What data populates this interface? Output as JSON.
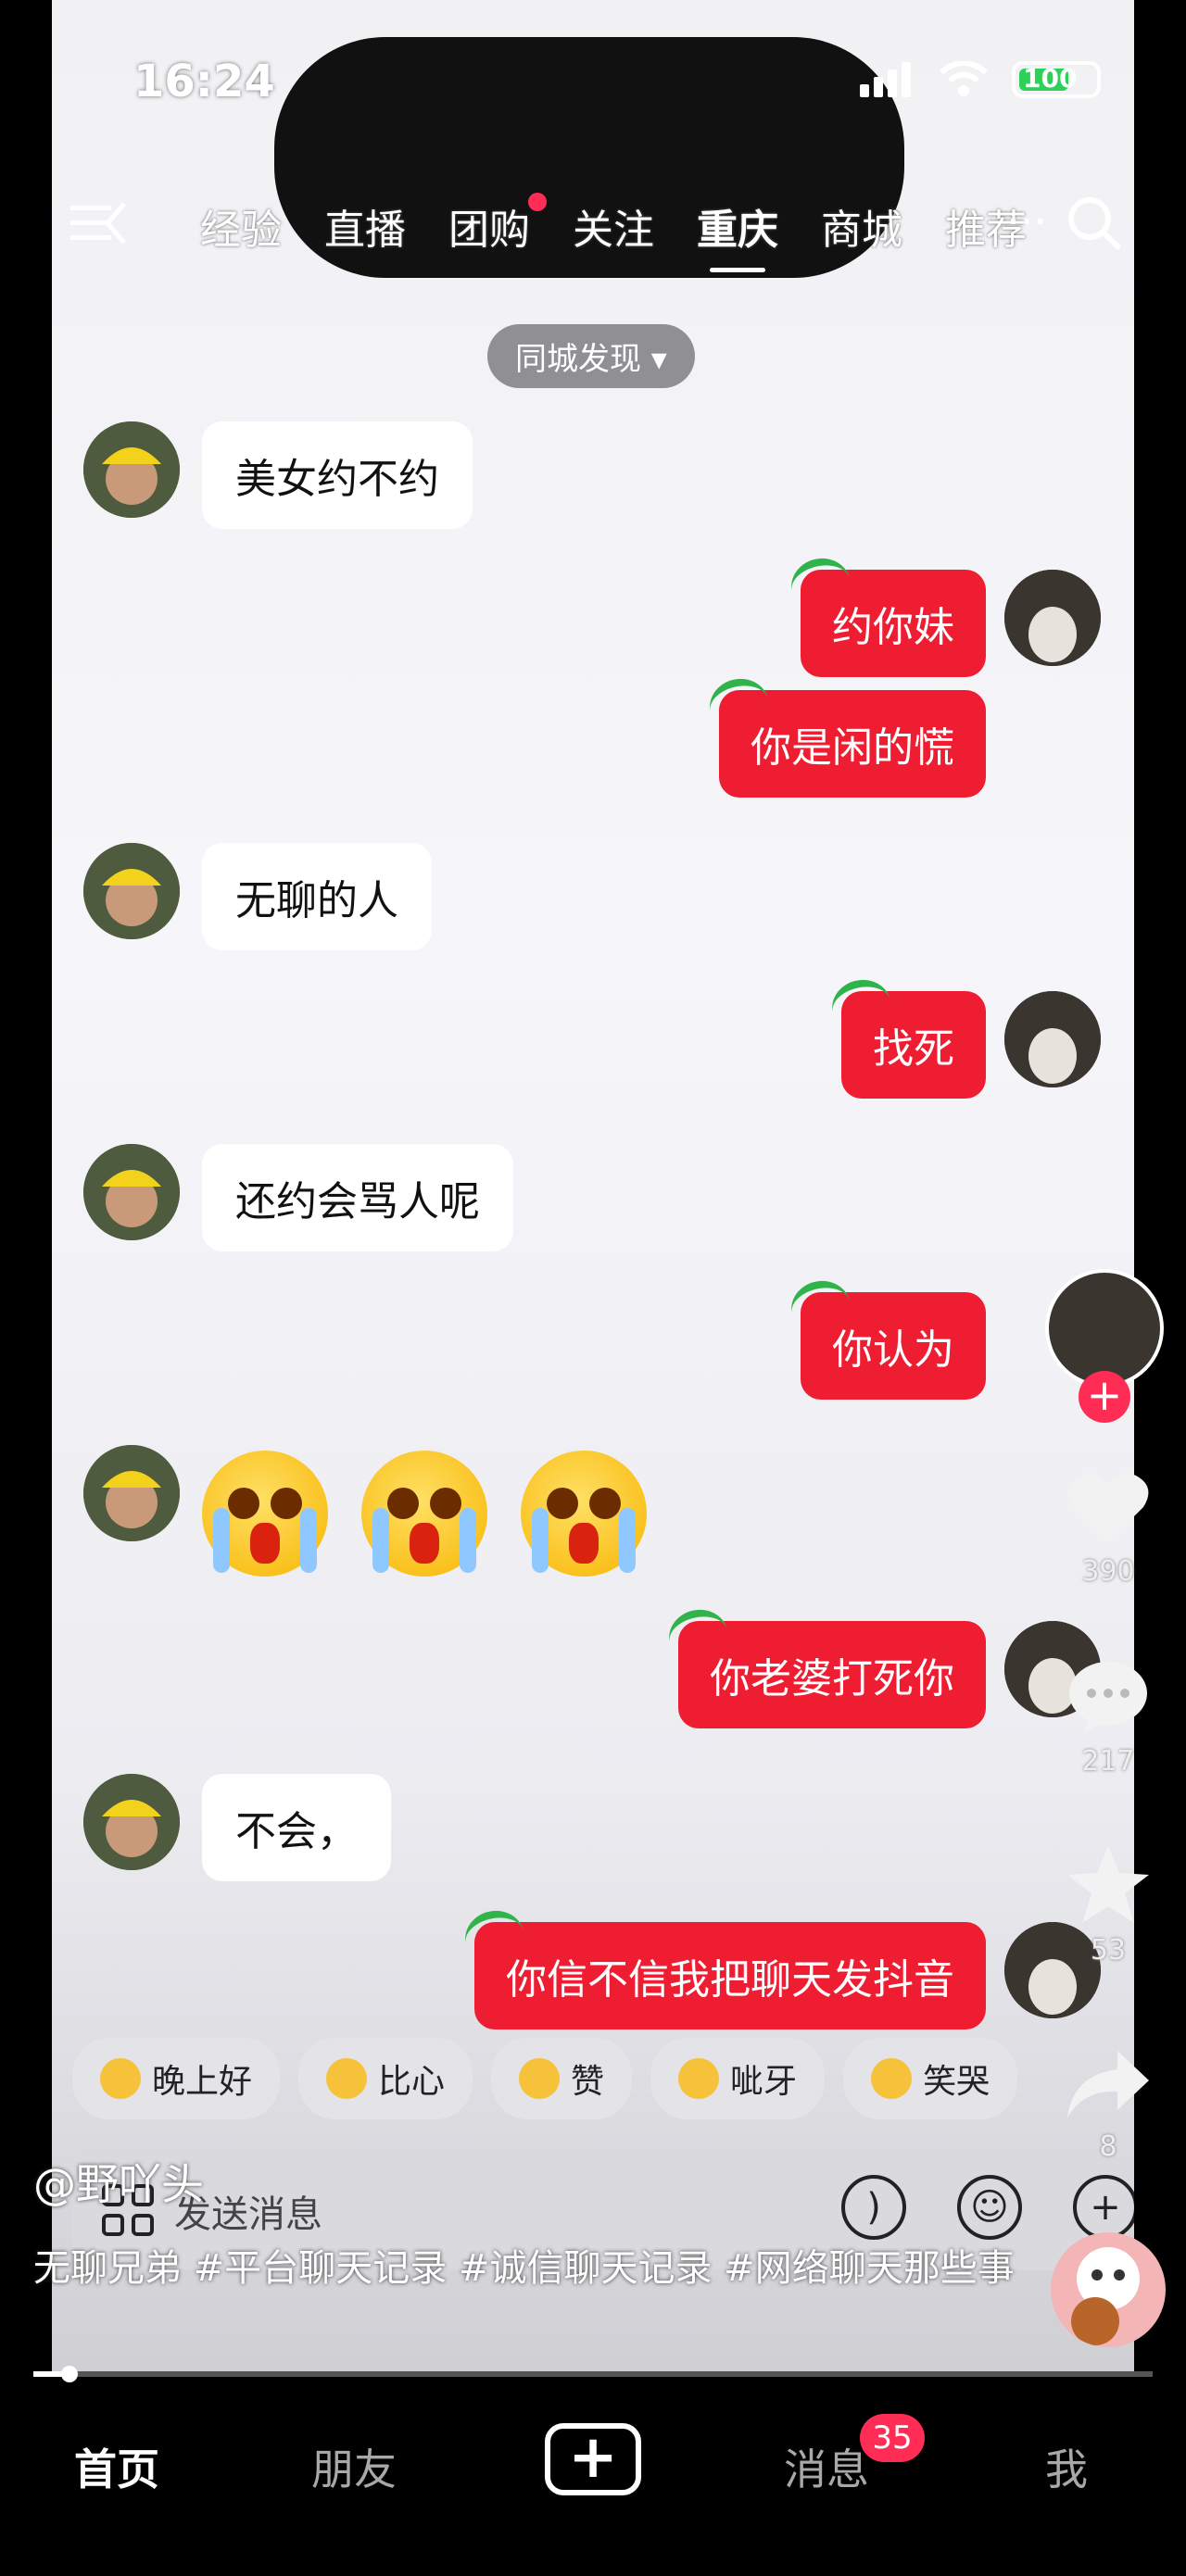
{
  "status_bar": {
    "time": "16:24",
    "battery": "100"
  },
  "top_nav": {
    "tabs": [
      {
        "label": "经验"
      },
      {
        "label": "直播"
      },
      {
        "label": "团购"
      },
      {
        "label": "关注"
      },
      {
        "label": "重庆",
        "active": true
      },
      {
        "label": "商城"
      },
      {
        "label": "推荐"
      }
    ],
    "more": "···"
  },
  "city_filter": "同城发现 ▾",
  "messages": [
    {
      "side": "left",
      "text": "美女约不约"
    },
    {
      "side": "right",
      "text": "约你妹"
    },
    {
      "side": "right",
      "text": "你是闲的慌"
    },
    {
      "side": "left",
      "text": "无聊的人"
    },
    {
      "side": "right",
      "text": "找死"
    },
    {
      "side": "left",
      "text": "还约会骂人呢"
    },
    {
      "side": "right",
      "text": "你认为"
    },
    {
      "side": "left",
      "emoji": "crying-face ×3"
    },
    {
      "side": "right",
      "text": "你老婆打死你"
    },
    {
      "side": "left",
      "text": "不会，"
    },
    {
      "side": "right",
      "text": "你信不信我把聊天发抖音"
    }
  ],
  "quick_replies": [
    "晚上好",
    "比心",
    "赞",
    "呲牙",
    "笑哭"
  ],
  "input": {
    "placeholder": "发送消息"
  },
  "side_actions": {
    "likes": "390",
    "comments": "217",
    "favorites": "53",
    "shares": "8"
  },
  "video": {
    "author": "@野吖头",
    "caption": "无聊兄弟 #平台聊天记录 #诚信聊天记录 #网络聊天那些事",
    "progress": 0.02
  },
  "bottom_tabs": {
    "home": "首页",
    "friends": "朋友",
    "messages": "消息",
    "messages_badge": "35",
    "me": "我"
  },
  "colors": {
    "accent_red": "#ee1d32",
    "badge_pink": "#ff2c55"
  }
}
